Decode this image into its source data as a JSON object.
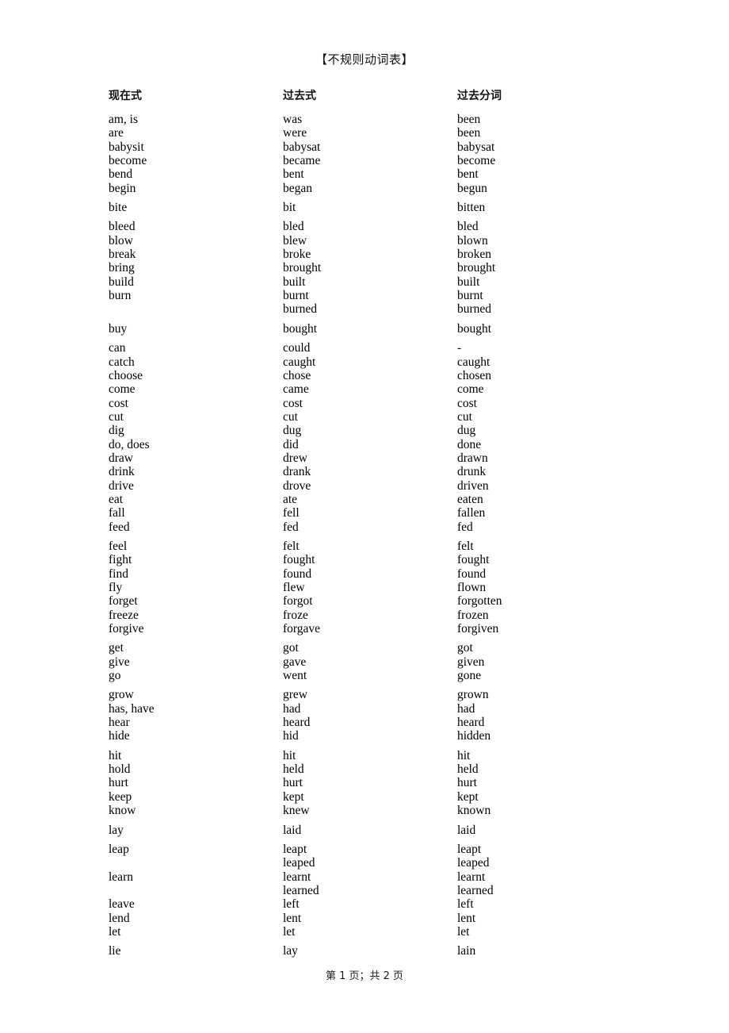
{
  "document": {
    "title": "【不规则动词表】",
    "footer": "第 1 页；共 2 页"
  },
  "headers": {
    "present": "现在式",
    "past": "过去式",
    "past_participle": "过去分词"
  },
  "rows": [
    {
      "present": "am, is",
      "past": "was",
      "participle": "been",
      "gap": false
    },
    {
      "present": "are",
      "past": "were",
      "participle": "been",
      "gap": false
    },
    {
      "present": "babysit",
      "past": "babysat",
      "participle": "babysat",
      "gap": false
    },
    {
      "present": "become",
      "past": "became",
      "participle": "become",
      "gap": false
    },
    {
      "present": "bend",
      "past": "bent",
      "participle": "bent",
      "gap": false
    },
    {
      "present": "begin",
      "past": "began",
      "participle": "begun",
      "gap": false
    },
    {
      "present": "bite",
      "past": "bit",
      "participle": "bitten",
      "gap": true
    },
    {
      "present": "bleed",
      "past": "bled",
      "participle": "bled",
      "gap": true
    },
    {
      "present": "blow",
      "past": "blew",
      "participle": "blown",
      "gap": false
    },
    {
      "present": "break",
      "past": "broke",
      "participle": "broken",
      "gap": false
    },
    {
      "present": "bring",
      "past": "brought",
      "participle": "brought",
      "gap": false
    },
    {
      "present": "build",
      "past": "built",
      "participle": "built",
      "gap": false
    },
    {
      "present": "burn",
      "past": "burnt",
      "participle": "burnt",
      "gap": false
    },
    {
      "present": "",
      "past": "burned",
      "participle": "burned",
      "gap": false
    },
    {
      "present": "buy",
      "past": "bought",
      "participle": "bought",
      "gap": true
    },
    {
      "present": "can",
      "past": "could",
      "participle": "-",
      "gap": true
    },
    {
      "present": "catch",
      "past": "caught",
      "participle": "caught",
      "gap": false
    },
    {
      "present": "choose",
      "past": "chose",
      "participle": "chosen",
      "gap": false
    },
    {
      "present": "come",
      "past": "came",
      "participle": "come",
      "gap": false
    },
    {
      "present": "cost",
      "past": "cost",
      "participle": "cost",
      "gap": false
    },
    {
      "present": "cut",
      "past": "cut",
      "participle": "cut",
      "gap": false
    },
    {
      "present": "dig",
      "past": "dug",
      "participle": "dug",
      "gap": false
    },
    {
      "present": "do, does",
      "past": "did",
      "participle": "done",
      "gap": false
    },
    {
      "present": "draw",
      "past": "drew",
      "participle": "drawn",
      "gap": false
    },
    {
      "present": "drink",
      "past": "drank",
      "participle": "drunk",
      "gap": false
    },
    {
      "present": "drive",
      "past": "drove",
      "participle": "driven",
      "gap": false
    },
    {
      "present": "eat",
      "past": "ate",
      "participle": "eaten",
      "gap": false
    },
    {
      "present": "fall",
      "past": "fell",
      "participle": "fallen",
      "gap": false
    },
    {
      "present": "feed",
      "past": "fed",
      "participle": "fed",
      "gap": false
    },
    {
      "present": "feel",
      "past": "felt",
      "participle": "felt",
      "gap": true
    },
    {
      "present": "fight",
      "past": "fought",
      "participle": "fought",
      "gap": false
    },
    {
      "present": "find",
      "past": "found",
      "participle": "found",
      "gap": false
    },
    {
      "present": "fly",
      "past": "flew",
      "participle": "flown",
      "gap": false
    },
    {
      "present": "forget",
      "past": "forgot",
      "participle": "forgotten",
      "gap": false
    },
    {
      "present": "freeze",
      "past": "froze",
      "participle": "frozen",
      "gap": false
    },
    {
      "present": "forgive",
      "past": "forgave",
      "participle": "forgiven",
      "gap": false
    },
    {
      "present": "get",
      "past": "got",
      "participle": "got",
      "gap": true
    },
    {
      "present": "give",
      "past": "gave",
      "participle": "given",
      "gap": false
    },
    {
      "present": "go",
      "past": "went",
      "participle": "gone",
      "gap": false
    },
    {
      "present": "grow",
      "past": "grew",
      "participle": "grown",
      "gap": true
    },
    {
      "present": "has, have",
      "past": "had",
      "participle": "had",
      "gap": false
    },
    {
      "present": "hear",
      "past": "heard",
      "participle": "heard",
      "gap": false
    },
    {
      "present": "hide",
      "past": "hid",
      "participle": "hidden",
      "gap": false
    },
    {
      "present": "hit",
      "past": "hit",
      "participle": "hit",
      "gap": true
    },
    {
      "present": "hold",
      "past": "held",
      "participle": "held",
      "gap": false
    },
    {
      "present": "hurt",
      "past": "hurt",
      "participle": "hurt",
      "gap": false
    },
    {
      "present": "keep",
      "past": "kept",
      "participle": "kept",
      "gap": false
    },
    {
      "present": "know",
      "past": "knew",
      "participle": "known",
      "gap": false
    },
    {
      "present": "lay",
      "past": "laid",
      "participle": "laid",
      "gap": true
    },
    {
      "present": "leap",
      "past": "leapt",
      "participle": "leapt",
      "gap": true
    },
    {
      "present": "",
      "past": "leaped",
      "participle": "leaped",
      "gap": false
    },
    {
      "present": "learn",
      "past": "learnt",
      "participle": "learnt",
      "gap": false
    },
    {
      "present": "",
      "past": "learned",
      "participle": "learned",
      "gap": false
    },
    {
      "present": "leave",
      "past": "left",
      "participle": "left",
      "gap": false
    },
    {
      "present": "lend",
      "past": "lent",
      "participle": "lent",
      "gap": false
    },
    {
      "present": "let",
      "past": "let",
      "participle": "let",
      "gap": false
    },
    {
      "present": "lie",
      "past": "lay",
      "participle": "lain",
      "gap": true
    }
  ]
}
